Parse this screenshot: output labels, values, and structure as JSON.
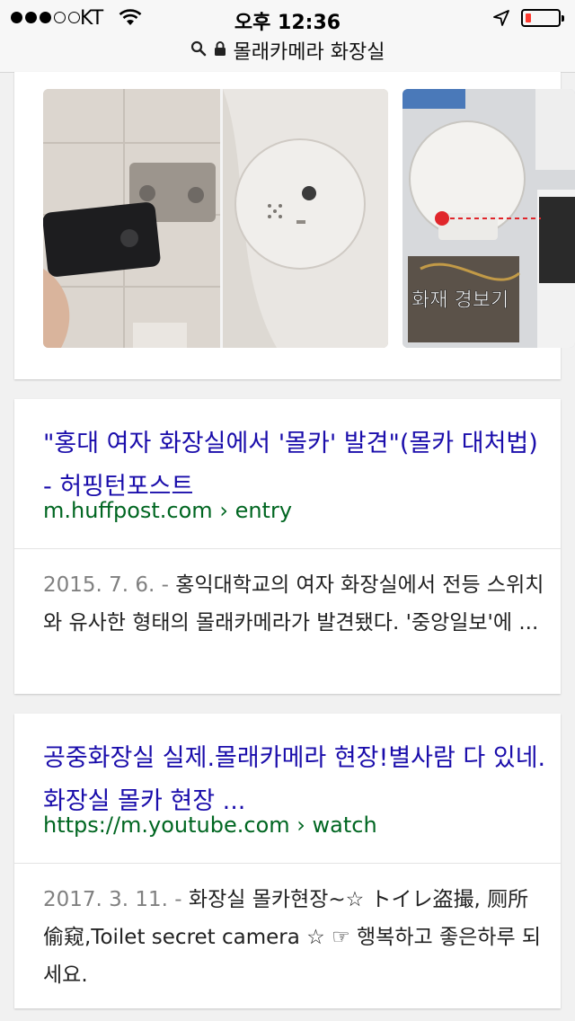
{
  "status_bar": {
    "carrier": "KT",
    "time": "오후 12:36"
  },
  "url_bar": {
    "query": "몰래카메라 화장실"
  },
  "image_carousel": {
    "images": [
      {
        "caption": ""
      },
      {
        "caption": "화재 경보기"
      }
    ]
  },
  "results": [
    {
      "title": "\"홍대 여자 화장실에서 '몰카' 발견\"(몰카 대처법) - 허핑턴포스트",
      "site": "m.huffpost.com",
      "path": "entry",
      "date": "2015. 7. 6. -",
      "snippet": "홍익대학교의 여자 화장실에서 전등 스위치와 유사한 형태의 몰래카메라가 발견됐다. '중앙일보'에 ..."
    },
    {
      "title": "공중화장실 실제.몰래카메라 현장!별사람 다 있네.화장실 몰카 현장 ...",
      "site": "https://m.youtube.com",
      "path": "watch",
      "date": "2017. 3. 11. -",
      "snippet": "화장실 몰카현장~☆ トイレ盗撮, 厕所偷窥,Toilet secret camera ☆ ☞ 행복하고 좋은하루 되세요."
    }
  ],
  "colors": {
    "link": "#1a0dab",
    "url": "#006621",
    "battery_low": "#ff3b30"
  }
}
